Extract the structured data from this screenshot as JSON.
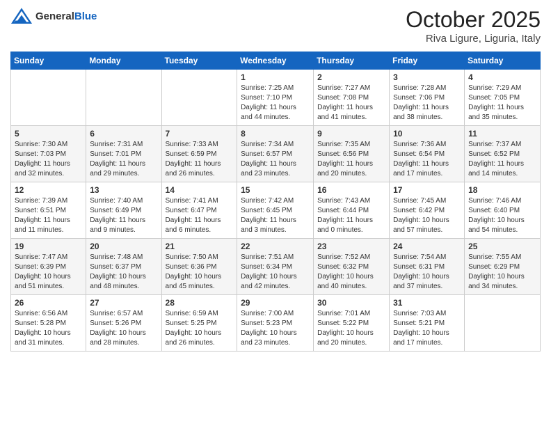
{
  "header": {
    "logo_general": "General",
    "logo_blue": "Blue",
    "month_title": "October 2025",
    "location": "Riva Ligure, Liguria, Italy"
  },
  "days_of_week": [
    "Sunday",
    "Monday",
    "Tuesday",
    "Wednesday",
    "Thursday",
    "Friday",
    "Saturday"
  ],
  "weeks": [
    [
      {
        "day": "",
        "info": ""
      },
      {
        "day": "",
        "info": ""
      },
      {
        "day": "",
        "info": ""
      },
      {
        "day": "1",
        "info": "Sunrise: 7:25 AM\nSunset: 7:10 PM\nDaylight: 11 hours and 44 minutes."
      },
      {
        "day": "2",
        "info": "Sunrise: 7:27 AM\nSunset: 7:08 PM\nDaylight: 11 hours and 41 minutes."
      },
      {
        "day": "3",
        "info": "Sunrise: 7:28 AM\nSunset: 7:06 PM\nDaylight: 11 hours and 38 minutes."
      },
      {
        "day": "4",
        "info": "Sunrise: 7:29 AM\nSunset: 7:05 PM\nDaylight: 11 hours and 35 minutes."
      }
    ],
    [
      {
        "day": "5",
        "info": "Sunrise: 7:30 AM\nSunset: 7:03 PM\nDaylight: 11 hours and 32 minutes."
      },
      {
        "day": "6",
        "info": "Sunrise: 7:31 AM\nSunset: 7:01 PM\nDaylight: 11 hours and 29 minutes."
      },
      {
        "day": "7",
        "info": "Sunrise: 7:33 AM\nSunset: 6:59 PM\nDaylight: 11 hours and 26 minutes."
      },
      {
        "day": "8",
        "info": "Sunrise: 7:34 AM\nSunset: 6:57 PM\nDaylight: 11 hours and 23 minutes."
      },
      {
        "day": "9",
        "info": "Sunrise: 7:35 AM\nSunset: 6:56 PM\nDaylight: 11 hours and 20 minutes."
      },
      {
        "day": "10",
        "info": "Sunrise: 7:36 AM\nSunset: 6:54 PM\nDaylight: 11 hours and 17 minutes."
      },
      {
        "day": "11",
        "info": "Sunrise: 7:37 AM\nSunset: 6:52 PM\nDaylight: 11 hours and 14 minutes."
      }
    ],
    [
      {
        "day": "12",
        "info": "Sunrise: 7:39 AM\nSunset: 6:51 PM\nDaylight: 11 hours and 11 minutes."
      },
      {
        "day": "13",
        "info": "Sunrise: 7:40 AM\nSunset: 6:49 PM\nDaylight: 11 hours and 9 minutes."
      },
      {
        "day": "14",
        "info": "Sunrise: 7:41 AM\nSunset: 6:47 PM\nDaylight: 11 hours and 6 minutes."
      },
      {
        "day": "15",
        "info": "Sunrise: 7:42 AM\nSunset: 6:45 PM\nDaylight: 11 hours and 3 minutes."
      },
      {
        "day": "16",
        "info": "Sunrise: 7:43 AM\nSunset: 6:44 PM\nDaylight: 11 hours and 0 minutes."
      },
      {
        "day": "17",
        "info": "Sunrise: 7:45 AM\nSunset: 6:42 PM\nDaylight: 10 hours and 57 minutes."
      },
      {
        "day": "18",
        "info": "Sunrise: 7:46 AM\nSunset: 6:40 PM\nDaylight: 10 hours and 54 minutes."
      }
    ],
    [
      {
        "day": "19",
        "info": "Sunrise: 7:47 AM\nSunset: 6:39 PM\nDaylight: 10 hours and 51 minutes."
      },
      {
        "day": "20",
        "info": "Sunrise: 7:48 AM\nSunset: 6:37 PM\nDaylight: 10 hours and 48 minutes."
      },
      {
        "day": "21",
        "info": "Sunrise: 7:50 AM\nSunset: 6:36 PM\nDaylight: 10 hours and 45 minutes."
      },
      {
        "day": "22",
        "info": "Sunrise: 7:51 AM\nSunset: 6:34 PM\nDaylight: 10 hours and 42 minutes."
      },
      {
        "day": "23",
        "info": "Sunrise: 7:52 AM\nSunset: 6:32 PM\nDaylight: 10 hours and 40 minutes."
      },
      {
        "day": "24",
        "info": "Sunrise: 7:54 AM\nSunset: 6:31 PM\nDaylight: 10 hours and 37 minutes."
      },
      {
        "day": "25",
        "info": "Sunrise: 7:55 AM\nSunset: 6:29 PM\nDaylight: 10 hours and 34 minutes."
      }
    ],
    [
      {
        "day": "26",
        "info": "Sunrise: 6:56 AM\nSunset: 5:28 PM\nDaylight: 10 hours and 31 minutes."
      },
      {
        "day": "27",
        "info": "Sunrise: 6:57 AM\nSunset: 5:26 PM\nDaylight: 10 hours and 28 minutes."
      },
      {
        "day": "28",
        "info": "Sunrise: 6:59 AM\nSunset: 5:25 PM\nDaylight: 10 hours and 26 minutes."
      },
      {
        "day": "29",
        "info": "Sunrise: 7:00 AM\nSunset: 5:23 PM\nDaylight: 10 hours and 23 minutes."
      },
      {
        "day": "30",
        "info": "Sunrise: 7:01 AM\nSunset: 5:22 PM\nDaylight: 10 hours and 20 minutes."
      },
      {
        "day": "31",
        "info": "Sunrise: 7:03 AM\nSunset: 5:21 PM\nDaylight: 10 hours and 17 minutes."
      },
      {
        "day": "",
        "info": ""
      }
    ]
  ]
}
